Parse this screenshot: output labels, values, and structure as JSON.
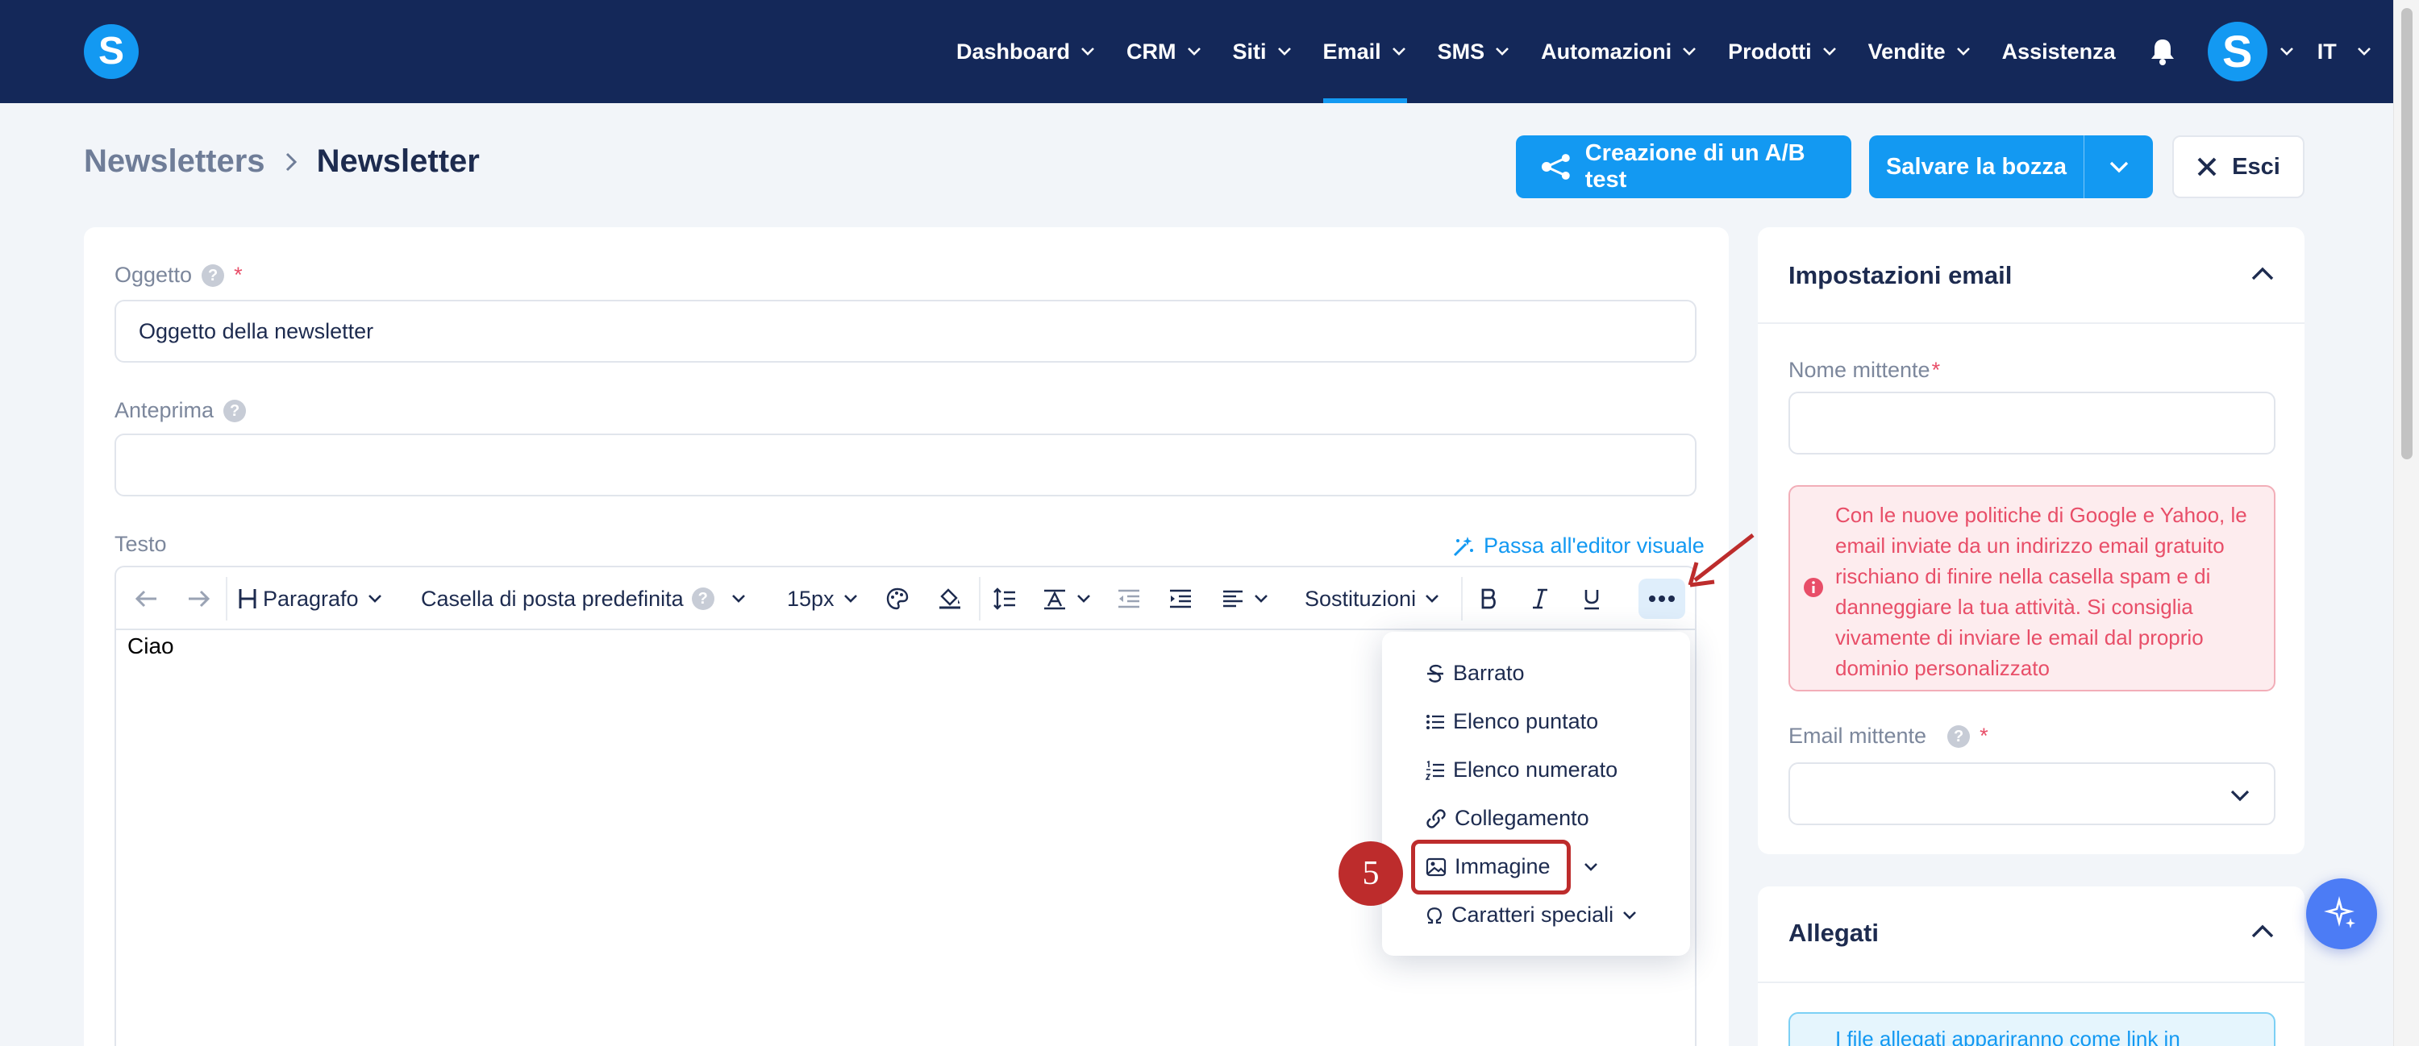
{
  "nav": {
    "logo": "S",
    "items": [
      {
        "label": "Dashboard",
        "dropdown": true
      },
      {
        "label": "CRM",
        "dropdown": true
      },
      {
        "label": "Siti",
        "dropdown": true
      },
      {
        "label": "Email",
        "dropdown": true,
        "active": true
      },
      {
        "label": "SMS",
        "dropdown": true
      },
      {
        "label": "Automazioni",
        "dropdown": true
      },
      {
        "label": "Prodotti",
        "dropdown": true
      },
      {
        "label": "Vendite",
        "dropdown": true
      },
      {
        "label": "Assistenza",
        "dropdown": false
      }
    ],
    "avatar": "S",
    "language": "IT"
  },
  "breadcrumb": {
    "root": "Newsletters",
    "current": "Newsletter"
  },
  "actions": {
    "ab_test": "Creazione di un A/B test",
    "save_draft": "Salvare la bozza",
    "exit": "Esci"
  },
  "form": {
    "subject": {
      "label": "Oggetto",
      "help": "?",
      "required": "*",
      "value": "Oggetto della newsletter"
    },
    "preview": {
      "label": "Anteprima",
      "help": "?",
      "value": ""
    },
    "text": {
      "label": "Testo",
      "switch_editor": "Passa all'editor visuale",
      "content": "Ciao"
    }
  },
  "toolbar": {
    "block_format": "Paragrafo",
    "font": "Casella di posta predefinita",
    "font_help": "?",
    "font_size": "15px",
    "substitutions": "Sostituzioni"
  },
  "more_menu": {
    "items": [
      {
        "label": "Barrato",
        "icon": "strikethrough-icon"
      },
      {
        "label": "Elenco puntato",
        "icon": "bullet-list-icon"
      },
      {
        "label": "Elenco numerato",
        "icon": "numbered-list-icon"
      },
      {
        "label": "Collegamento",
        "icon": "link-icon"
      },
      {
        "label": "Immagine",
        "icon": "image-icon"
      },
      {
        "label": "Caratteri speciali",
        "icon": "omega-icon"
      }
    ]
  },
  "annotation": {
    "step": "5",
    "color": "#bd2c2c"
  },
  "email_settings": {
    "title": "Impostazioni email",
    "sender_name": {
      "label": "Nome mittente",
      "required": "*",
      "value": ""
    },
    "warning": "Con le nuove politiche di Google e Yahoo, le email inviate da un indirizzo email gratuito rischiano di finire nella casella spam e di danneggiare la tua attività. Si consiglia vivamente di inviare le email dal proprio dominio personalizzato",
    "sender_email": {
      "label": "Email mittente",
      "help": "?",
      "required": "*",
      "value": ""
    }
  },
  "attachments": {
    "title": "Allegati",
    "info": "I file allegati appariranno come link in"
  },
  "colors": {
    "nav_bg": "#142859",
    "accent": "#1399f2",
    "text_dark": "#1d2b4f",
    "warning_text": "#e84e68",
    "warning_bg": "#fdecee",
    "page_bg": "#f2f5f9"
  }
}
